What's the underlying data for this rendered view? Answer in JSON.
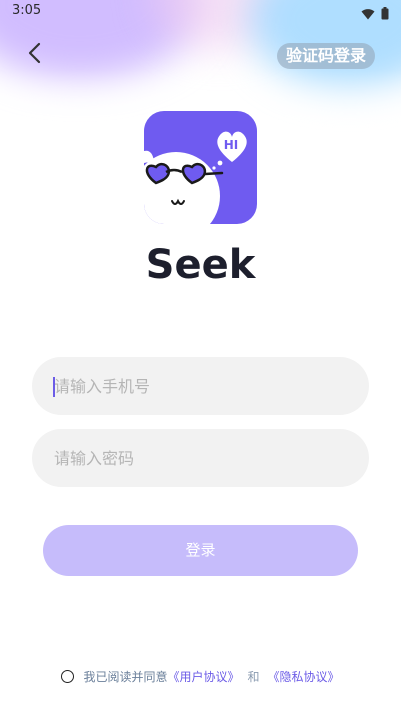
{
  "status_bar": {
    "time": "3:05",
    "icons": [
      "wifi-icon",
      "battery-icon"
    ]
  },
  "header": {
    "back_icon": "chevron-left-icon",
    "code_login_label": "验证码登录"
  },
  "logo": {
    "bubble_text": "HI"
  },
  "app_name": "Seek",
  "form": {
    "phone_placeholder": "请输入手机号",
    "phone_value": "",
    "password_placeholder": "请输入密码",
    "password_value": ""
  },
  "login_label": "登录",
  "agreement": {
    "prefix": "我已阅读并同意",
    "user_agreement": "《用户协议》",
    "and": "和",
    "privacy_agreement": "《隐私协议》",
    "checked": false
  },
  "colors": {
    "accent": "#6c5ce7",
    "logo_bg": "#6f5bf0",
    "login_button": "#c6bcfb",
    "input_bg": "#f2f2f2"
  }
}
